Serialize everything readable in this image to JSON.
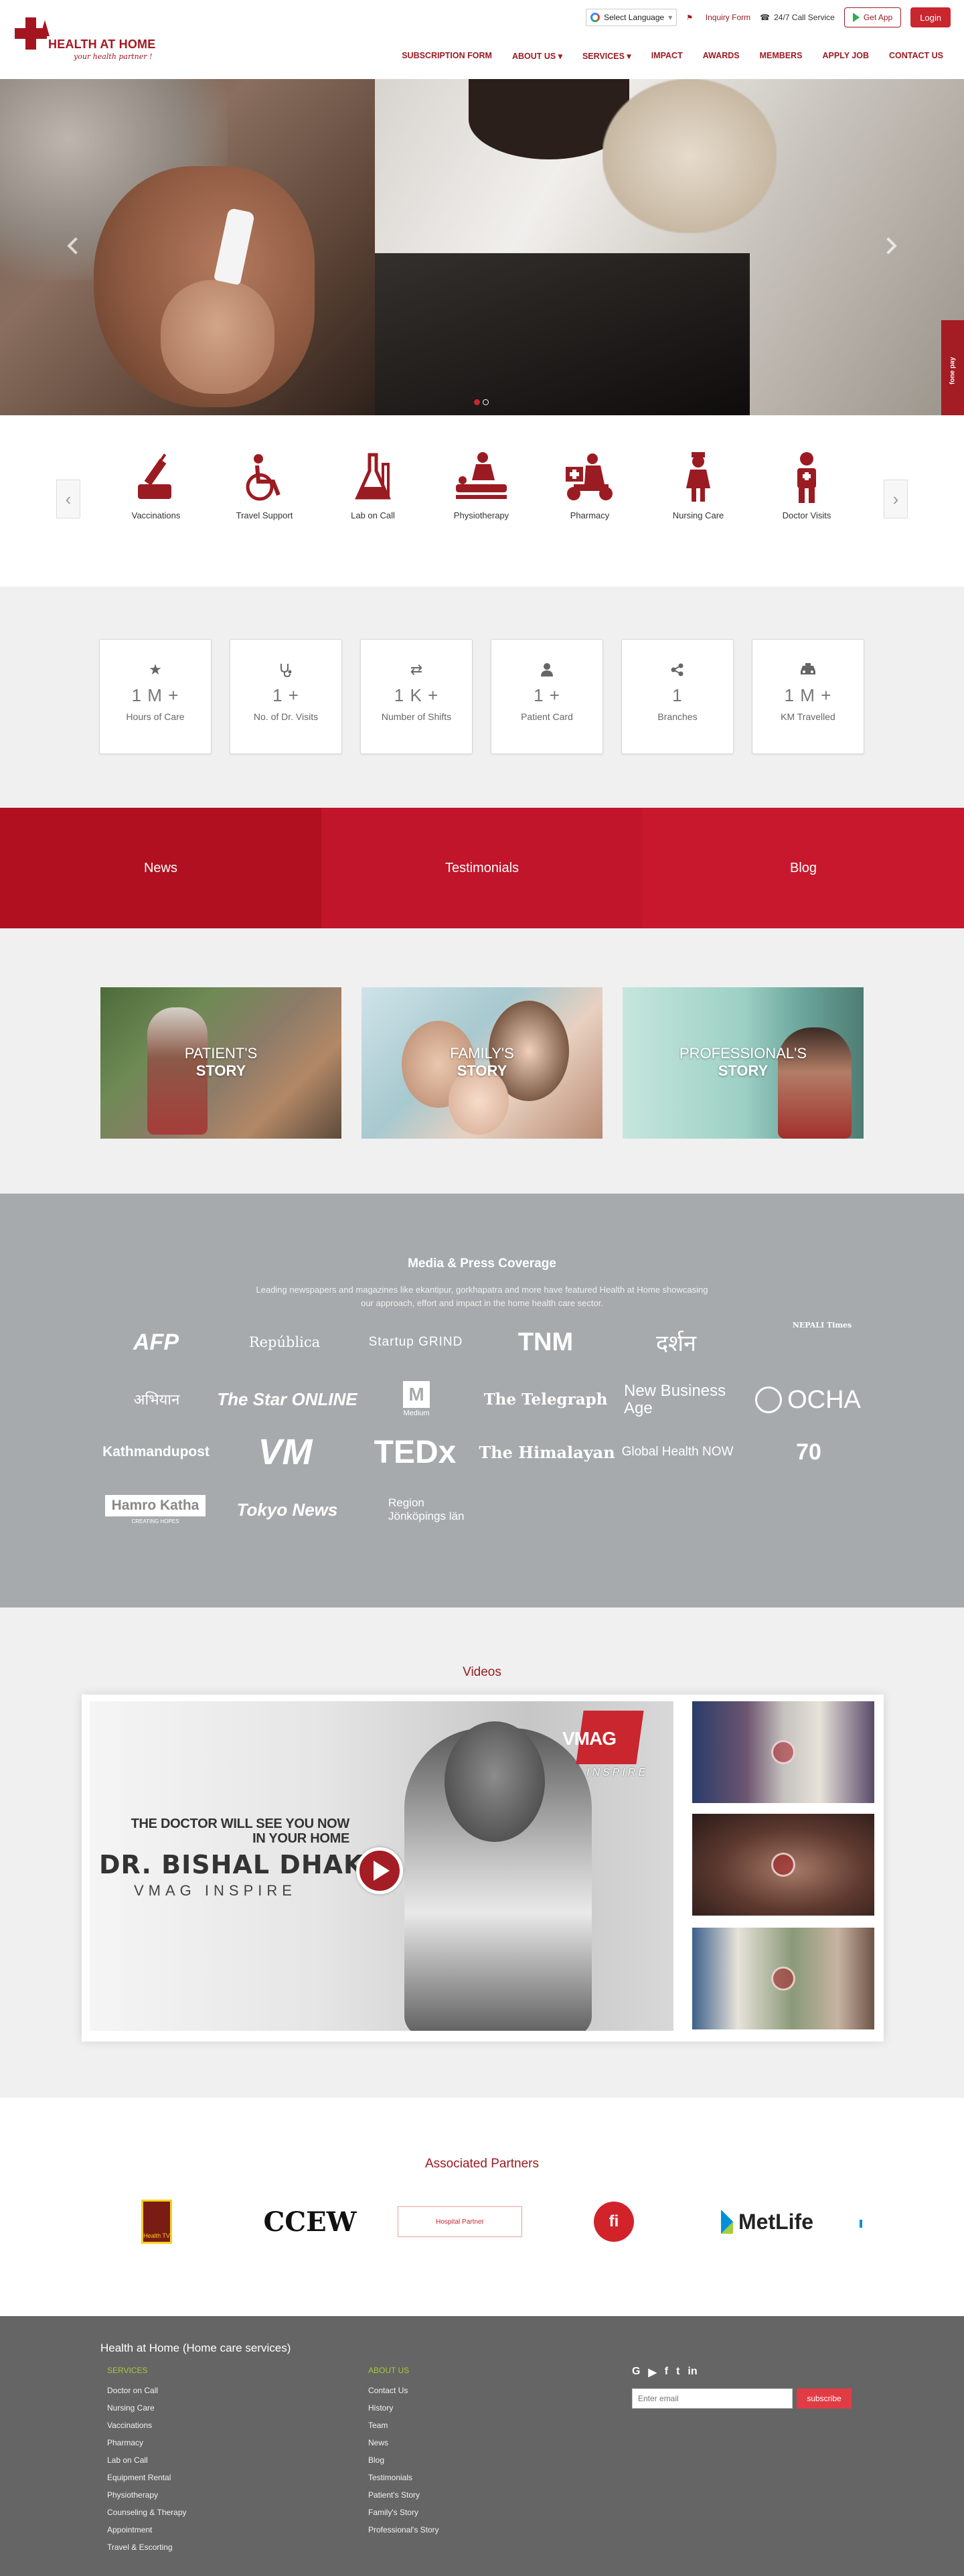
{
  "header": {
    "logo_title": "HEALTH AT HOME",
    "logo_tagline": "your health partner !",
    "language_label": "Select Language",
    "inquiry": "Inquiry Form",
    "call": "24/7 Call Service",
    "get_app": "Get App",
    "login": "Login",
    "nav": [
      "SUBSCRIPTION FORM",
      "ABOUT US ▾",
      "SERVICES ▾",
      "IMPACT",
      "AWARDS",
      "MEMBERS",
      "APPLY JOB",
      "CONTACT US"
    ]
  },
  "hero": {
    "side_badge": "fone pay"
  },
  "services": [
    {
      "label": "Vaccinations",
      "icon": "syringe-icon"
    },
    {
      "label": "Travel Support",
      "icon": "wheelchair-icon"
    },
    {
      "label": "Lab on Call",
      "icon": "lab-flask-icon"
    },
    {
      "label": "Physiotherapy",
      "icon": "massage-icon"
    },
    {
      "label": "Pharmacy",
      "icon": "delivery-scooter-icon"
    },
    {
      "label": "Nursing Care",
      "icon": "nurse-icon"
    },
    {
      "label": "Doctor Visits",
      "icon": "doctor-icon"
    }
  ],
  "stats": [
    {
      "value": "1 M +",
      "label": "Hours of Care",
      "icon": "star-icon"
    },
    {
      "value": "1 +",
      "label": "No. of Dr. Visits",
      "icon": "stethoscope-icon"
    },
    {
      "value": "1 K +",
      "label": "Number of Shifts",
      "icon": "exchange-icon"
    },
    {
      "value": "1 +",
      "label": "Patient Card",
      "icon": "user-icon"
    },
    {
      "value": "1",
      "label": "Branches",
      "icon": "share-icon"
    },
    {
      "value": "1 M +",
      "label": "KM Travelled",
      "icon": "taxi-icon"
    }
  ],
  "tabs": [
    {
      "label": "News",
      "color": "#b0101f"
    },
    {
      "label": "Testimonials",
      "color": "#c0152a"
    },
    {
      "label": "Blog",
      "color": "#c8182e"
    }
  ],
  "stories": [
    {
      "line1": "PATIENT'S",
      "line2": "STORY"
    },
    {
      "line1": "FAMILY'S",
      "line2": "STORY"
    },
    {
      "line1": "PROFESSIONAL'S",
      "line2": "STORY"
    }
  ],
  "media": {
    "title": "Media & Press Coverage",
    "description": "Leading newspapers and magazines like ekantipur, gorkhapatra and more have featured Health at Home showcasing our approach, effort and impact in the home health care sector.",
    "logos": [
      "AFP",
      "República",
      "Startup GRIND",
      "TNM",
      "दर्शन",
      "NEPALI Times",
      "अभियान",
      "The Star ONLINE",
      "Medium",
      "The Telegraph",
      "New Business Age",
      "OCHA",
      "Kathmandupost",
      "VM",
      "TEDx",
      "The Himalayan",
      "Global Health NOW",
      "70",
      "Hamro Katha",
      "Tokyo News",
      "Region Jönköpings län"
    ]
  },
  "videos": {
    "title": "Videos",
    "main_line1": "THE DOCTOR WILL SEE YOU NOW",
    "main_line1b": "IN YOUR HOME",
    "main_line2": "DR. BISHAL DHAKAL",
    "main_line3": "VMAG INSPIRE",
    "vmag_logo": "VMAG",
    "vmag_sub": "INSPIRE"
  },
  "partners": {
    "title": "Associated Partners",
    "items": [
      "Health TV",
      "CCEW",
      "Hospital Partner",
      "fi",
      "MetLife"
    ]
  },
  "footer": {
    "title": "Health at Home (Home care services)",
    "services_heading": "SERVICES",
    "services": [
      "Doctor on Call",
      "Nursing Care",
      "Vaccinations",
      "Pharmacy",
      "Lab on Call",
      "Equipment Rental",
      "Physiotherapy",
      "Counseling & Therapy",
      "Appointment",
      "Travel & Escorting"
    ],
    "about_heading": "ABOUT US",
    "about": [
      "Contact Us",
      "History",
      "Team",
      "News",
      "Blog",
      "Testimonials",
      "Patient's Story",
      "Family's Story",
      "Professional's Story"
    ],
    "email_placeholder": "Enter email",
    "subscribe": "subscribe"
  }
}
